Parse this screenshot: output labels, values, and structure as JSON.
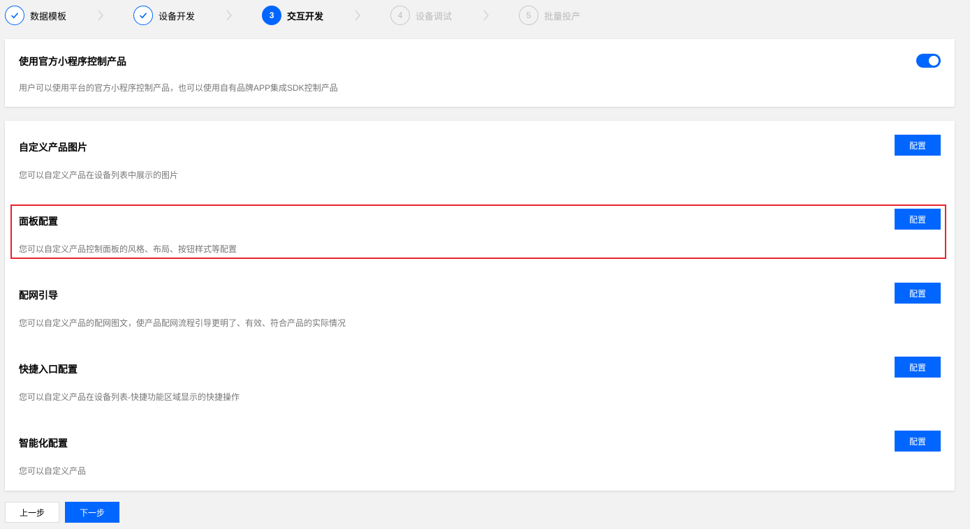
{
  "stepper": {
    "steps": [
      {
        "number": "",
        "label": "数据模板",
        "state": "done"
      },
      {
        "number": "",
        "label": "设备开发",
        "state": "done"
      },
      {
        "number": "3",
        "label": "交互开发",
        "state": "active"
      },
      {
        "number": "4",
        "label": "设备调试",
        "state": "todo"
      },
      {
        "number": "5",
        "label": "批量投产",
        "state": "todo"
      }
    ]
  },
  "official_app": {
    "title": "使用官方小程序控制产品",
    "description": "用户可以使用平台的官方小程序控制产品，也可以使用自有品牌APP集成SDK控制产品",
    "enabled": true
  },
  "config_items": [
    {
      "title": "自定义产品图片",
      "description": "您可以自定义产品在设备列表中展示的图片",
      "button_label": "配置"
    },
    {
      "title": "面板配置",
      "description": "您可以自定义产品控制面板的风格、布局、按钮样式等配置",
      "button_label": "配置"
    },
    {
      "title": "配网引导",
      "description": "您可以自定义产品的配网图文，使产品配网流程引导更明了、有效、符合产品的实际情况",
      "button_label": "配置"
    },
    {
      "title": "快捷入口配置",
      "description": "您可以自定义产品在设备列表-快捷功能区域显示的快捷操作",
      "button_label": "配置"
    },
    {
      "title": "智能化配置",
      "description": "您可以自定义产品",
      "button_label": "配置"
    }
  ],
  "footer": {
    "prev_label": "上一步",
    "next_label": "下一步"
  },
  "colors": {
    "primary": "#0066ff",
    "highlight": "#e8232f"
  }
}
